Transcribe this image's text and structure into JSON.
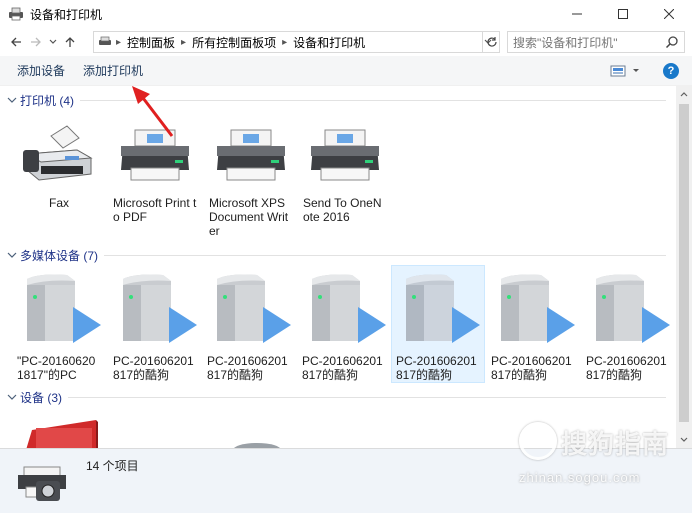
{
  "window": {
    "title": "设备和打印机",
    "minimize": "—",
    "maximize": "☐",
    "close": "✕"
  },
  "address": {
    "crumbs": [
      "控制面板",
      "所有控制面板项",
      "设备和打印机"
    ],
    "search_placeholder": "搜索\"设备和打印机\""
  },
  "toolbar": {
    "add_device": "添加设备",
    "add_printer": "添加打印机",
    "help": "?"
  },
  "groups": {
    "printers": {
      "title": "打印机 (4)",
      "items": [
        {
          "label": "Fax"
        },
        {
          "label": "Microsoft Print to PDF"
        },
        {
          "label": "Microsoft XPS Document Writer"
        },
        {
          "label": "Send To OneNote 2016"
        }
      ]
    },
    "media": {
      "title": "多媒体设备 (7)",
      "items": [
        {
          "label": "\"PC-201606201817\"的PC"
        },
        {
          "label": "PC-201606201817的酷狗"
        },
        {
          "label": "PC-201606201817的酷狗"
        },
        {
          "label": "PC-201606201817的酷狗"
        },
        {
          "label": "PC-201606201817的酷狗",
          "selected": true
        },
        {
          "label": "PC-201606201817的酷狗"
        },
        {
          "label": "PC-201606201817的酷狗"
        }
      ]
    },
    "devices": {
      "title": "设备 (3)"
    }
  },
  "status": {
    "count": "14 个项目"
  },
  "watermark": {
    "text": "搜狗指南",
    "url": "zhinan.sogou.com"
  },
  "colors": {
    "accent": "#1979ca",
    "group_title": "#1e3287",
    "selected_bg": "#e5f3ff",
    "annotation_arrow": "#e02020"
  }
}
